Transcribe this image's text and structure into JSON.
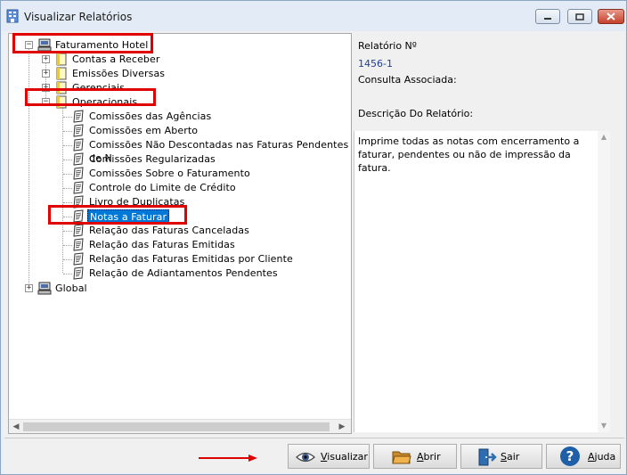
{
  "window": {
    "title": "Visualizar Relatórios"
  },
  "tree": {
    "root1": "Faturamento Hotel",
    "groups": [
      "Contas a Receber",
      "Emissões Diversas",
      "Gerenciais",
      "Operacionais"
    ],
    "reports": [
      "Comissões das Agências",
      "Comissões em Aberto",
      "Comissões Não Descontadas nas Faturas Pendentes de N",
      "Comissões Regularizadas",
      "Comissões Sobre o Faturamento",
      "Controle do Limite de Crédito",
      "Livro de Duplicatas",
      "Notas a Faturar",
      "Relação das Faturas Canceladas",
      "Relação das Faturas Emitidas",
      "Relação das Faturas Emitidas por Cliente",
      "Relação de Adiantamentos Pendentes"
    ],
    "selected_report": "Notas a Faturar",
    "root2": "Global"
  },
  "info": {
    "report_number_label": "Relatório Nº",
    "report_number_value": "1456-1",
    "query_label": "Consulta Associada:",
    "description_label": "Descrição Do Relatório:",
    "description_text": "Imprime todas as notas com encerramento a faturar, pendentes ou não de impressão da fatura."
  },
  "buttons": {
    "visualizar": "Visualizar",
    "abrir": "Abrir",
    "sair": "Sair",
    "ajuda": "Ajuda"
  },
  "colors": {
    "annotation_red": "#e00000",
    "selection_blue": "#0078d7"
  }
}
